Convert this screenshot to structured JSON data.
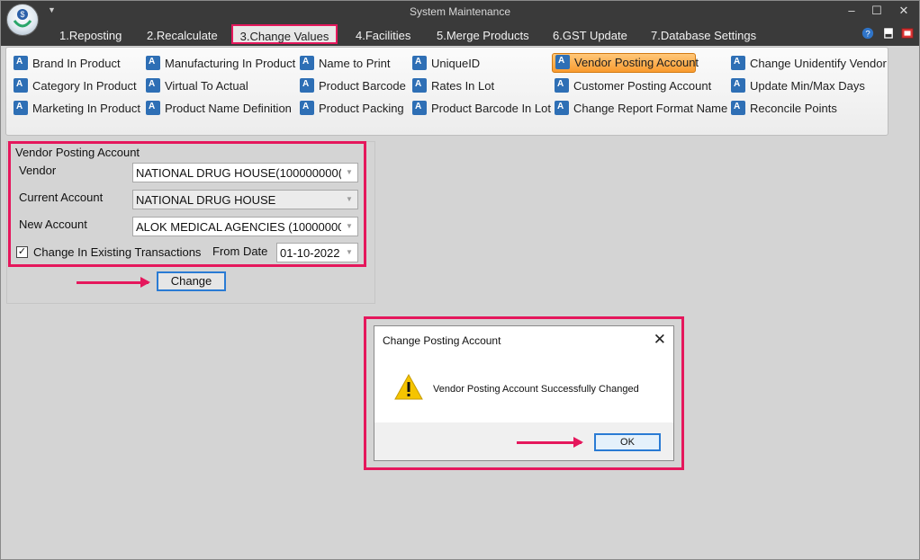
{
  "window": {
    "title": "System Maintenance"
  },
  "tabs": [
    "1.Reposting",
    "2.Recalculate",
    "3.Change Values",
    "4.Facilities",
    "5.Merge Products",
    "6.GST Update",
    "7.Database Settings"
  ],
  "active_tab": "3.Change Values",
  "ribbon": {
    "items": [
      "Brand In Product",
      "Category In Product",
      "Marketing In Product",
      "Manufacturing In Product",
      "Virtual To Actual",
      "Product Name Definition",
      "Name to Print",
      "Product Barcode",
      "Product Packing",
      "UniqueID",
      "Rates In Lot",
      "Product Barcode In Lot",
      "Vendor Posting Account",
      "Customer Posting Account",
      "Change Report Format Name",
      "Change Unidentify Vendor",
      "Update Min/Max Days",
      "Reconcile Points"
    ],
    "active_item": "Vendor Posting Account"
  },
  "form": {
    "title": "Vendor Posting Account",
    "vendor_label": "Vendor",
    "vendor_value": "NATIONAL DRUG HOUSE(100000000(",
    "current_label": "Current Account",
    "current_value": "NATIONAL DRUG HOUSE",
    "new_label": "New Account",
    "new_value": "ALOK MEDICAL AGENCIES (10000000(",
    "checkbox_label": "Change In Existing Transactions",
    "checkbox_checked": true,
    "from_date_label": "From Date",
    "from_date_value": "01-10-2022",
    "change_button": "Change"
  },
  "dialog": {
    "title": "Change Posting Account",
    "message": "Vendor Posting Account Successfully Changed",
    "ok_button": "OK"
  },
  "colors": {
    "highlight": "#e5175c",
    "titlebar": "#3a3a3a",
    "active_item": "#f99b2f",
    "focus_border": "#2a7bd4"
  }
}
